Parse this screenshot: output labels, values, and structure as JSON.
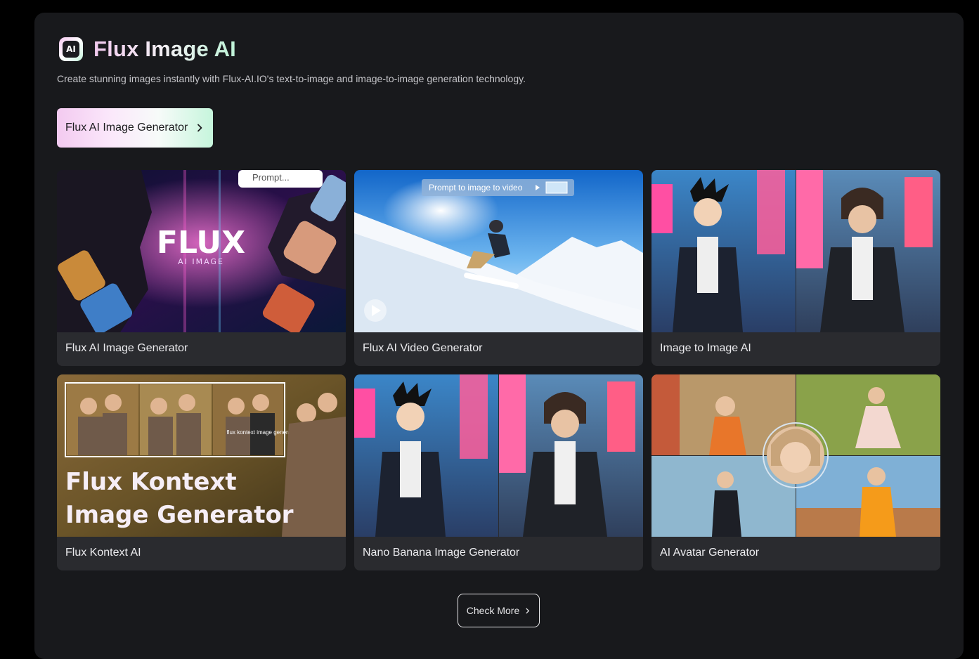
{
  "header": {
    "logo_text": "AI",
    "title": "Flux Image AI",
    "subtitle": "Create stunning images instantly with Flux-AI.IO's text-to-image and image-to-image generation technology."
  },
  "primary_button": {
    "label": "Flux AI Image Generator"
  },
  "cards": [
    {
      "label": "Flux AI Image Generator",
      "thumb_text": {
        "big": "FLUX",
        "small": "AI IMAGE",
        "prompt": "Prompt..."
      }
    },
    {
      "label": "Flux AI Video Generator",
      "thumb_text": {
        "prompt": "Prompt to image to video"
      }
    },
    {
      "label": "Image to Image AI"
    },
    {
      "label": "Flux Kontext AI",
      "thumb_text": {
        "line1": "Flux Kontext",
        "line2": "Image Generator",
        "shirt": "flux kontext image generator"
      }
    },
    {
      "label": "Nano Banana Image Generator"
    },
    {
      "label": "AI Avatar Generator"
    }
  ],
  "check_more": {
    "label": "Check More"
  },
  "colors": {
    "page_bg": "#000000",
    "panel_bg": "#18191c",
    "card_bg": "#2a2b2f",
    "accent_pink": "#f3caf0",
    "accent_mint": "#c6f5dc"
  },
  "icons": [
    "ai-logo-icon",
    "chevron-right-icon",
    "play-icon"
  ]
}
